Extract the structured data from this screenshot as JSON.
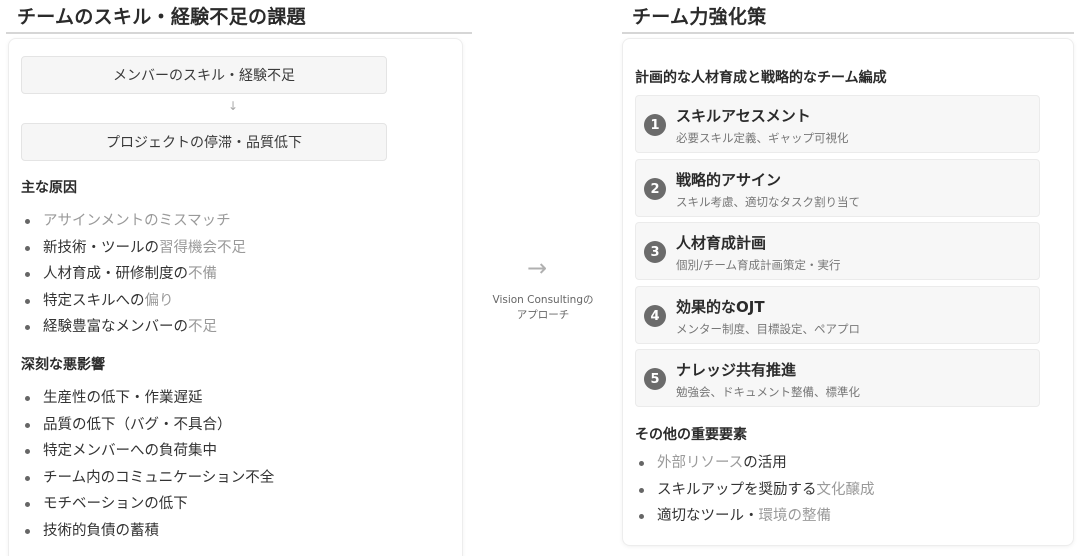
{
  "left": {
    "heading": "チームのスキル・経験不足の課題",
    "flow": {
      "top": "メンバーのスキル・経験不足",
      "arrow": "↓",
      "bottom": "プロジェクトの停滞・品質低下"
    },
    "causes": {
      "title": "主な原因",
      "items": [
        {
          "pre": "",
          "em": "アサインメントのミスマッチ"
        },
        {
          "pre": "新技術・ツールの",
          "em": "習得機会不足"
        },
        {
          "pre": "人材育成・研修制度の",
          "em": "不備"
        },
        {
          "pre": "特定スキルへの",
          "em": "偏り"
        },
        {
          "pre": "経験豊富なメンバーの",
          "em": "不足"
        }
      ]
    },
    "impacts": {
      "title": "深刻な悪影響",
      "items": [
        "生産性の低下・作業遅延",
        "品質の低下（バグ・不具合）",
        "特定メンバーへの負荷集中",
        "チーム内のコミュニケーション不全",
        "モチベーションの低下",
        "技術的負債の蓄積"
      ]
    }
  },
  "middle": {
    "arrow": "→",
    "caption_line1": "Vision Consultingの",
    "caption_line2": "アプローチ"
  },
  "right": {
    "heading": "チーム力強化策",
    "subtitle": "計画的な人材育成と戦略的なチーム編成",
    "steps": [
      {
        "num": "1",
        "title": "スキルアセスメント",
        "desc": "必要スキル定義、ギャップ可視化"
      },
      {
        "num": "2",
        "title": "戦略的アサイン",
        "desc": "スキル考慮、適切なタスク割り当て"
      },
      {
        "num": "3",
        "title": "人材育成計画",
        "desc": "個別/チーム育成計画策定・実行"
      },
      {
        "num": "4",
        "title": "効果的なOJT",
        "desc": "メンター制度、目標設定、ペアプロ"
      },
      {
        "num": "5",
        "title": "ナレッジ共有推進",
        "desc": "勉強会、ドキュメント整備、標準化"
      }
    ],
    "others": {
      "title": "その他の重要要素",
      "items": [
        {
          "pre": "",
          "em": "外部リソース",
          "post": "の活用"
        },
        {
          "pre": "スキルアップを奨励する",
          "em": "文化醸成",
          "post": ""
        },
        {
          "pre": "適切なツール・",
          "em": "環境の整備",
          "post": ""
        }
      ]
    }
  }
}
